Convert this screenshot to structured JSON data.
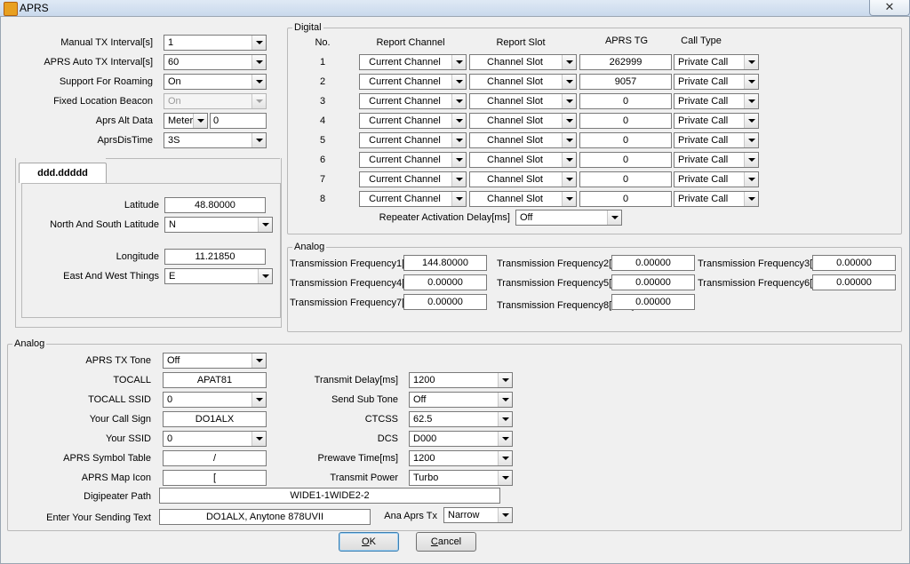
{
  "window": {
    "title": "APRS",
    "close_glyph": "✕"
  },
  "left": {
    "rows": [
      {
        "label": "Manual TX Interval[s]",
        "value": "1",
        "disabled": false
      },
      {
        "label": "APRS Auto TX Interval[s]",
        "value": "60",
        "disabled": false
      },
      {
        "label": "Support For Roaming",
        "value": "On",
        "disabled": false
      },
      {
        "label": "Fixed Location Beacon",
        "value": "On",
        "disabled": true
      }
    ],
    "alt": {
      "label": "Aprs Alt Data",
      "unit": "Meter",
      "value": "0"
    },
    "dis": {
      "label": "AprsDisTime",
      "value": "3S"
    }
  },
  "location": {
    "tab": "ddd.ddddd",
    "latitude_label": "Latitude",
    "latitude": "48.80000",
    "ns_label": "North And South Latitude",
    "ns": "N",
    "longitude_label": "Longitude",
    "longitude": "11.21850",
    "ew_label": "East  And West Things",
    "ew": "E"
  },
  "digital": {
    "title": "Digital",
    "headers": {
      "no": "No.",
      "report_channel": "Report Channel",
      "report_slot": "Report Slot",
      "aprs_tg": "APRS TG",
      "call_type": "Call Type"
    },
    "rows": [
      {
        "no": "1",
        "channel": "Current Channel",
        "slot": "Channel Slot",
        "tg": "262999",
        "call": "Private Call"
      },
      {
        "no": "2",
        "channel": "Current Channel",
        "slot": "Channel Slot",
        "tg": "9057",
        "call": "Private Call"
      },
      {
        "no": "3",
        "channel": "Current Channel",
        "slot": "Channel Slot",
        "tg": "0",
        "call": "Private Call"
      },
      {
        "no": "4",
        "channel": "Current Channel",
        "slot": "Channel Slot",
        "tg": "0",
        "call": "Private Call"
      },
      {
        "no": "5",
        "channel": "Current Channel",
        "slot": "Channel Slot",
        "tg": "0",
        "call": "Private Call"
      },
      {
        "no": "6",
        "channel": "Current Channel",
        "slot": "Channel Slot",
        "tg": "0",
        "call": "Private Call"
      },
      {
        "no": "7",
        "channel": "Current Channel",
        "slot": "Channel Slot",
        "tg": "0",
        "call": "Private Call"
      },
      {
        "no": "8",
        "channel": "Current Channel",
        "slot": "Channel Slot",
        "tg": "0",
        "call": "Private Call"
      }
    ],
    "repeater_label": "Repeater Activation Delay[ms]",
    "repeater_value": "Off"
  },
  "analog_freq": {
    "title": "Analog",
    "items": [
      {
        "label": "Transmission Frequency1[MHz]",
        "value": "144.80000"
      },
      {
        "label": "Transmission Frequency2[MHz]",
        "value": "0.00000"
      },
      {
        "label": "Transmission Frequency3[MHz]",
        "value": "0.00000"
      },
      {
        "label": "Transmission Frequency4[MHz]",
        "value": "0.00000"
      },
      {
        "label": "Transmission Frequency5[MHz]",
        "value": "0.00000"
      },
      {
        "label": "Transmission Frequency6[MHz]",
        "value": "0.00000"
      },
      {
        "label": "Transmission Frequency7[MHz]",
        "value": "0.00000"
      },
      {
        "label": "Transmission Frequency8[MHz]",
        "value": "0.00000"
      }
    ]
  },
  "analog": {
    "title": "Analog",
    "tx_tone": {
      "label": "APRS TX Tone",
      "value": "Off"
    },
    "tocall": {
      "label": "TOCALL",
      "value": "APAT81"
    },
    "tocall_ssid": {
      "label": "TOCALL SSID",
      "value": "0"
    },
    "callsign": {
      "label": "Your Call Sign",
      "value": "DO1ALX"
    },
    "ssid": {
      "label": "Your SSID",
      "value": "0"
    },
    "symbol_table": {
      "label": "APRS Symbol Table",
      "value": "/"
    },
    "map_icon": {
      "label": "APRS Map Icon",
      "value": "["
    },
    "digipeater": {
      "label": "Digipeater Path",
      "value": "WIDE1-1WIDE2-2"
    },
    "sending_text": {
      "label": "Enter Your Sending Text",
      "value": "DO1ALX, Anytone 878UVII"
    },
    "transmit_delay": {
      "label": "Transmit Delay[ms]",
      "value": "1200"
    },
    "send_sub_tone": {
      "label": "Send Sub Tone",
      "value": "Off"
    },
    "ctcss": {
      "label": "CTCSS",
      "value": "62.5"
    },
    "dcs": {
      "label": "DCS",
      "value": "D000"
    },
    "prewave": {
      "label": "Prewave Time[ms]",
      "value": "1200"
    },
    "transmit_power": {
      "label": "Transmit Power",
      "value": "Turbo"
    },
    "ana_tx": {
      "label": "Ana Aprs Tx",
      "value": "Narrow"
    }
  },
  "buttons": {
    "ok_accel": "O",
    "ok_rest": "K",
    "cancel_accel": "C",
    "cancel_rest": "ancel"
  }
}
